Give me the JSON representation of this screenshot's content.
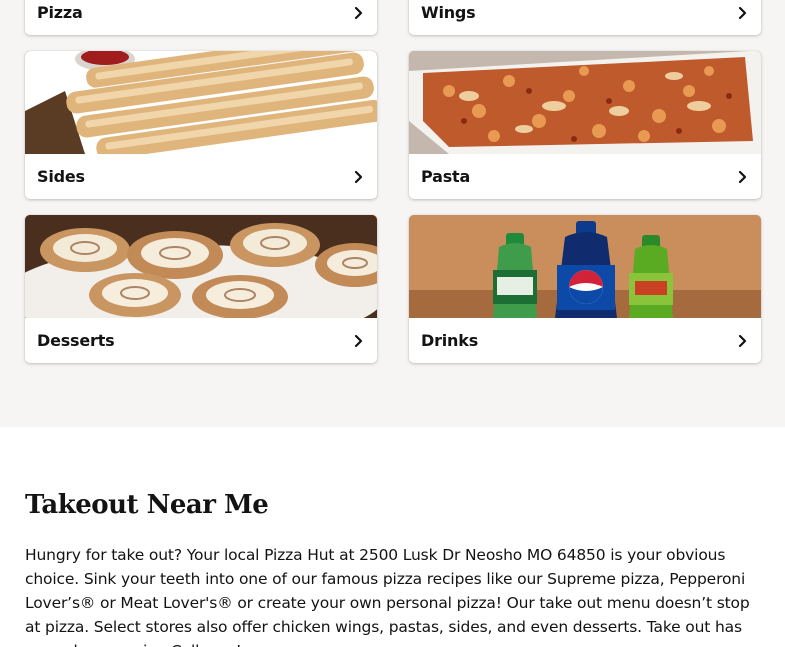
{
  "menu": {
    "categories": [
      {
        "label": "Pizza"
      },
      {
        "label": "Wings"
      },
      {
        "label": "Sides"
      },
      {
        "label": "Pasta"
      },
      {
        "label": "Desserts"
      },
      {
        "label": "Drinks"
      }
    ]
  },
  "takeout": {
    "heading": "Takeout Near Me",
    "body": "Hungry for take out? Your local Pizza Hut at 2500 Lusk Dr Neosho MO 64850 is your obvious choice. Sink your teeth into one of our famous pizza recipes like our Supreme pizza, Pepperoni Lover’s® or Meat Lover's® or create your own personal pizza! Our take out menu doesn’t stop at pizza. Select stores also offer chicken wings, pastas, sides, and even desserts. Take out has never been easier. Call now!"
  },
  "colors": {
    "section_bg": "#f6f5f3",
    "text": "#131313"
  }
}
